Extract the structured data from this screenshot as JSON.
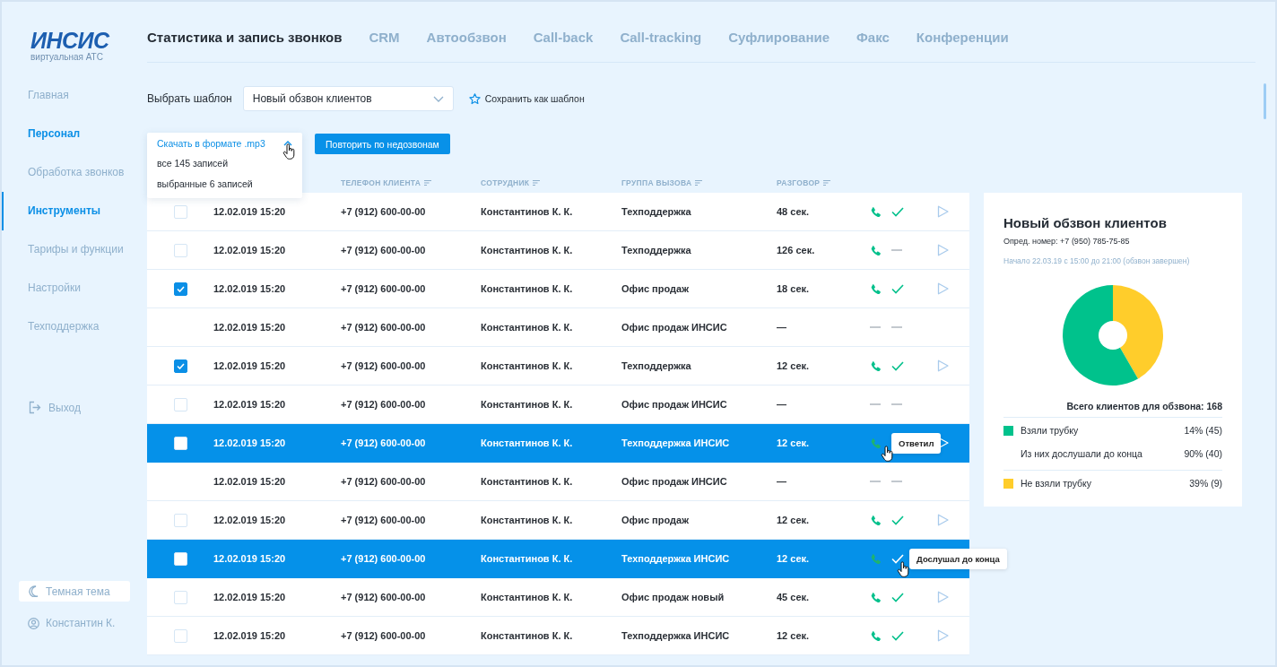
{
  "logo": {
    "mark": "ИНСИС",
    "subtitle": "виртуальная АТС"
  },
  "sidebar": {
    "items": [
      {
        "label": "Главная",
        "selected": false,
        "highlighted": false
      },
      {
        "label": "Персонал",
        "selected": false,
        "highlighted": true
      },
      {
        "label": "Обработка звонков",
        "selected": false,
        "highlighted": false
      },
      {
        "label": "Инструменты",
        "selected": true,
        "highlighted": false
      },
      {
        "label": "Тарифы и функции",
        "selected": false,
        "highlighted": false
      },
      {
        "label": "Настройки",
        "selected": false,
        "highlighted": false
      },
      {
        "label": "Техподдержка",
        "selected": false,
        "highlighted": false
      }
    ],
    "logout": "Выход",
    "theme_button": "Темная тема",
    "user": "Константин К."
  },
  "tabs": [
    {
      "label": "Статистика и запись звонков",
      "selected": true
    },
    {
      "label": "CRM",
      "selected": false
    },
    {
      "label": "Автообзвон",
      "selected": false
    },
    {
      "label": "Call-back",
      "selected": false
    },
    {
      "label": "Call-tracking",
      "selected": false
    },
    {
      "label": "Суфлирование",
      "selected": false
    },
    {
      "label": "Факс",
      "selected": false
    },
    {
      "label": "Конференции",
      "selected": false
    }
  ],
  "template": {
    "label": "Выбрать шаблон",
    "value": "Новый обзвон клиентов",
    "save_link": "Сохранить как шаблон"
  },
  "download_menu": {
    "title": "Скачать в формате .mp3",
    "expanded": true,
    "items": [
      "все 145 записей",
      "выбранные 6 записей"
    ]
  },
  "retry_button": "Повторить по недозвонам",
  "table": {
    "columns": [
      "ТЕЛЕФОН КЛИЕНТА",
      "СОТРУДНИК",
      "ГРУППА ВЫЗОВА",
      "РАЗГОВОР"
    ],
    "rows": [
      {
        "kind": "checkbox",
        "checked": false,
        "selected": false,
        "date": "12.02.019 15:20",
        "phone": "+7 (912) 600-00-00",
        "employee": "Константинов К. К.",
        "group": "Техподдержка",
        "duration": "48 сек.",
        "answered": true,
        "listened": true,
        "recording": true
      },
      {
        "kind": "checkbox",
        "checked": false,
        "selected": false,
        "date": "12.02.019 15:20",
        "phone": "+7 (912) 600-00-00",
        "employee": "Константинов К. К.",
        "group": "Техподдержка",
        "duration": "126 сек.",
        "answered": true,
        "listened": false,
        "recording": true
      },
      {
        "kind": "checkbox",
        "checked": true,
        "selected": false,
        "date": "12.02.019 15:20",
        "phone": "+7 (912) 600-00-00",
        "employee": "Константинов К. К.",
        "group": "Офис продаж",
        "duration": "18 сек.",
        "answered": true,
        "listened": true,
        "recording": true
      },
      {
        "kind": "plain",
        "selected": false,
        "date": "12.02.019 15:20",
        "phone": "+7 (912) 600-00-00",
        "employee": "Константинов К. К.",
        "group": "Офис продаж ИНСИС",
        "duration": "—",
        "answered": false,
        "listened": false,
        "recording": false
      },
      {
        "kind": "checkbox",
        "checked": true,
        "selected": false,
        "date": "12.02.019 15:20",
        "phone": "+7 (912) 600-00-00",
        "employee": "Константинов К. К.",
        "group": "Техподдержка",
        "duration": "12 сек.",
        "answered": true,
        "listened": true,
        "recording": true
      },
      {
        "kind": "checkbox",
        "checked": false,
        "selected": false,
        "date": "12.02.019 15:20",
        "phone": "+7 (912) 600-00-00",
        "employee": "Константинов К. К.",
        "group": "Офис продаж ИНСИС",
        "duration": "—",
        "answered": false,
        "listened": false,
        "recording": false
      },
      {
        "kind": "checkbox",
        "checked": false,
        "selected": true,
        "date": "12.02.019 15:20",
        "phone": "+7 (912) 600-00-00",
        "employee": "Константинов К. К.",
        "group": "Техподдержка ИНСИС",
        "duration": "12 сек.",
        "answered": true,
        "recording": true,
        "answered_tooltip": "Ответил"
      },
      {
        "kind": "plain",
        "selected": false,
        "date": "12.02.019 15:20",
        "phone": "+7 (912) 600-00-00",
        "employee": "Константинов К. К.",
        "group": "Офис продаж ИНСИС",
        "duration": "—",
        "answered": false,
        "listened": false,
        "recording": false
      },
      {
        "kind": "checkbox",
        "checked": false,
        "selected": false,
        "date": "12.02.019 15:20",
        "phone": "+7 (912) 600-00-00",
        "employee": "Константинов К. К.",
        "group": "Офис продаж",
        "duration": "12 сек.",
        "answered": true,
        "listened": true,
        "recording": true
      },
      {
        "kind": "checkbox",
        "checked": false,
        "selected": true,
        "date": "12.02.019 15:20",
        "phone": "+7 (912) 600-00-00",
        "employee": "Константинов К. К.",
        "group": "Техподдержка ИНСИС",
        "duration": "12 сек.",
        "answered": true,
        "listened": true,
        "listened_tooltip": "Дослушал до конца"
      },
      {
        "kind": "checkbox",
        "checked": false,
        "selected": false,
        "date": "12.02.019 15:20",
        "phone": "+7 (912) 600-00-00",
        "employee": "Константинов К. К.",
        "group": "Офис продаж новый",
        "duration": "45 сек.",
        "answered": true,
        "listened": true,
        "recording": true
      },
      {
        "kind": "checkbox",
        "checked": false,
        "selected": false,
        "date": "12.02.019 15:20",
        "phone": "+7 (912) 600-00-00",
        "employee": "Константинов К. К.",
        "group": "Техподдержка ИНСИС",
        "duration": "12 сек.",
        "answered": true,
        "listened": true,
        "recording": true
      }
    ]
  },
  "summary": {
    "title": "Новый обзвон клиентов",
    "caller_id": "Опред. номер: +7 (950) 785-75-85",
    "period": "Начало 22.03.19 с 15:00 до 21:00 (обзвон завершен)",
    "total": "Всего клиентов для обзвона: 168",
    "legend": [
      {
        "label": "Взяли трубку",
        "value": "14% (45)",
        "color": "#00c28c"
      },
      {
        "label": "Из них дослушали до конца",
        "value": "90% (40)"
      },
      {
        "label": "Не взяли трубку",
        "value": "39% (9)",
        "color": "#ffcd2b"
      }
    ]
  }
}
